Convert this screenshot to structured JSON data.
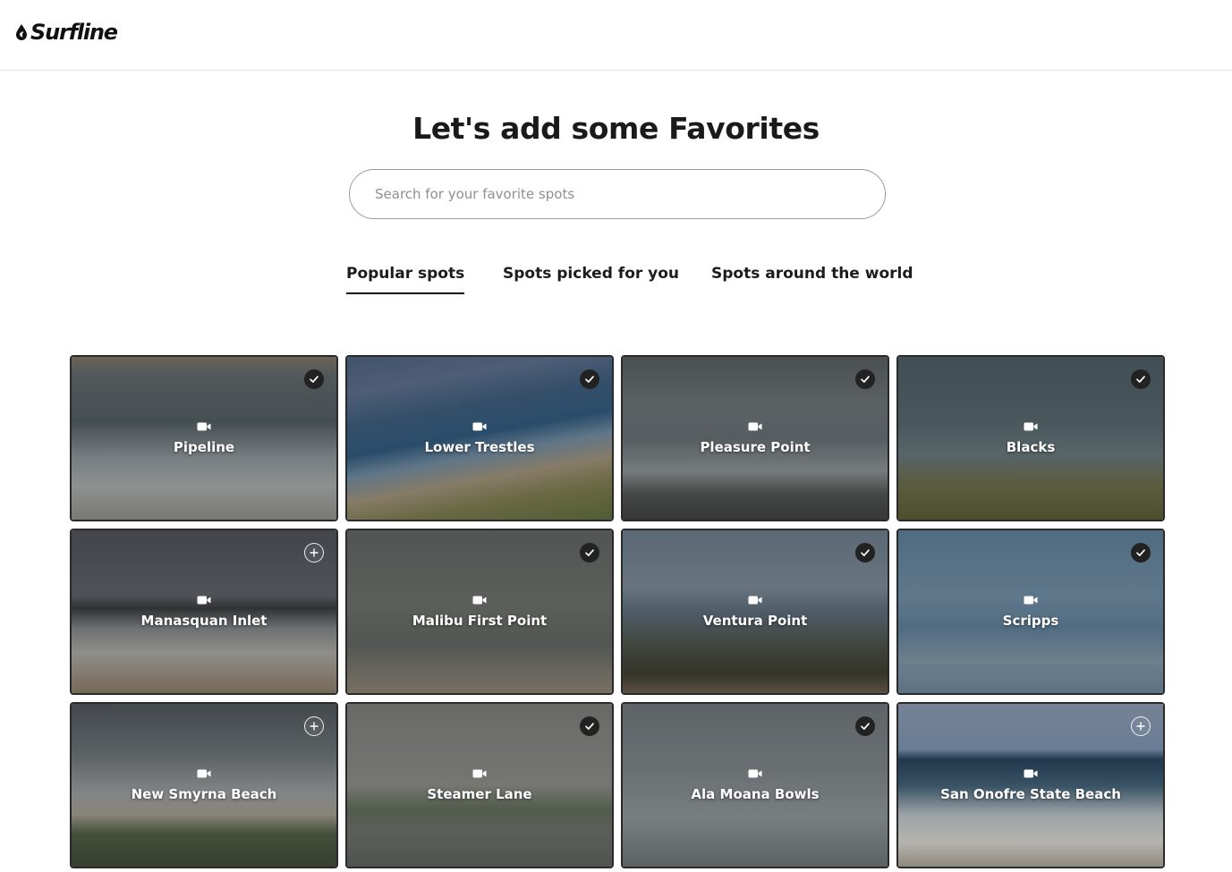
{
  "header": {
    "logo_text": "Surfline",
    "logo_icon": "drop-icon"
  },
  "main": {
    "title": "Let's add some Favorites",
    "search_placeholder": "Search for your favorite spots",
    "tabs": [
      {
        "label": "Popular spots",
        "active": true
      },
      {
        "label": "Spots picked for you",
        "active": false
      },
      {
        "label": "Spots around the world",
        "active": false
      }
    ]
  },
  "spots": [
    {
      "name": "Pipeline",
      "favorited": true,
      "icon": "camera-icon"
    },
    {
      "name": "Lower Trestles",
      "favorited": true,
      "icon": "camera-icon"
    },
    {
      "name": "Pleasure Point",
      "favorited": true,
      "icon": "camera-icon"
    },
    {
      "name": "Blacks",
      "favorited": true,
      "icon": "camera-icon"
    },
    {
      "name": "Manasquan Inlet",
      "favorited": false,
      "icon": "camera-icon"
    },
    {
      "name": "Malibu First Point",
      "favorited": true,
      "icon": "camera-icon"
    },
    {
      "name": "Ventura Point",
      "favorited": true,
      "icon": "camera-icon"
    },
    {
      "name": "Scripps",
      "favorited": true,
      "icon": "camera-icon"
    },
    {
      "name": "New Smyrna Beach",
      "favorited": false,
      "icon": "camera-icon"
    },
    {
      "name": "Steamer Lane",
      "favorited": true,
      "icon": "camera-icon"
    },
    {
      "name": "Ala Moana Bowls",
      "favorited": true,
      "icon": "camera-icon"
    },
    {
      "name": "San Onofre State Beach",
      "favorited": false,
      "icon": "camera-icon"
    }
  ],
  "colors": {
    "text": "#171717",
    "border": "#e4e4e4",
    "badge_fill": "#222222"
  }
}
